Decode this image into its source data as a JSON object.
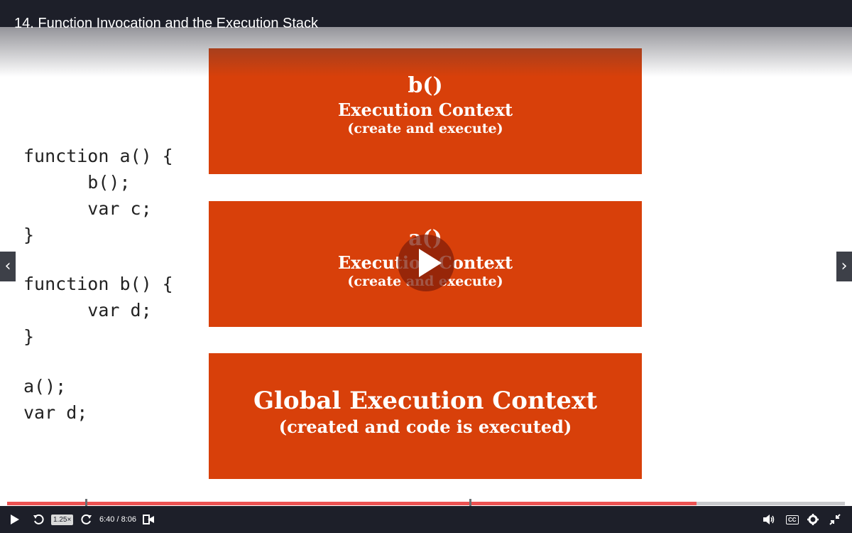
{
  "title": "14. Function Invocation and the Execution Stack",
  "code_lines": [
    "function a() {",
    "      b();",
    "      var c;",
    "}",
    "",
    "function b() {",
    "      var d;",
    "}",
    "",
    "a();",
    "var d;"
  ],
  "boxes": {
    "b": {
      "name": "b()",
      "label": "Execution Context",
      "sub": "(create and execute)"
    },
    "a": {
      "name": "a()",
      "label": "Execution Context",
      "sub": "(create and execute)"
    },
    "global": {
      "label": "Global Execution Context",
      "sub": "(created and code is executed)"
    }
  },
  "player": {
    "speed": "1.25×",
    "time": "6:40 / 8:06",
    "progress_fraction": 0.823,
    "colors": {
      "accent": "#ec5252",
      "slide_box": "#d8400a",
      "bar": "#1d1f29"
    }
  },
  "nav": {
    "prev": "‹",
    "next": "›"
  }
}
